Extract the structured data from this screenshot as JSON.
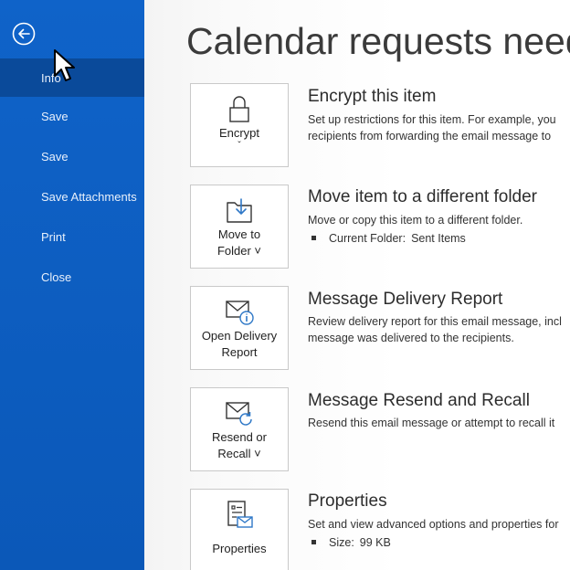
{
  "sidebar": {
    "items": [
      {
        "label": "Info"
      },
      {
        "label": "Save"
      },
      {
        "label": "Save"
      },
      {
        "label": "Save Attachments"
      },
      {
        "label": "Print"
      },
      {
        "label": "Close"
      }
    ]
  },
  "main": {
    "title": "Calendar requests need",
    "sections": [
      {
        "button_label": "Encrypt",
        "title": "Encrypt this item",
        "desc": [
          "Set up restrictions for this item. For example, you",
          "recipients from forwarding the email message to"
        ]
      },
      {
        "button_label_1": "Move to",
        "button_label_2": "Folder ˅",
        "title": "Move item to a different folder",
        "desc": [
          "Move or copy this item to a different folder."
        ],
        "bullet_key": "Current Folder:",
        "bullet_val": "Sent Items"
      },
      {
        "button_label_1": "Open Delivery",
        "button_label_2": "Report",
        "title": "Message Delivery Report",
        "desc": [
          "Review delivery report for this email message, incl",
          "message was delivered to the recipients."
        ]
      },
      {
        "button_label_1": "Resend or",
        "button_label_2": "Recall ˅",
        "title": "Message Resend and Recall",
        "desc": [
          "Resend this email message or attempt to recall it"
        ]
      },
      {
        "button_label": "Properties",
        "title": "Properties",
        "desc": [
          "Set and view advanced options and properties for"
        ],
        "bullet_key": "Size:",
        "bullet_val": "99 KB"
      }
    ]
  },
  "icons": {
    "back": "back-arrow-icon",
    "encrypt": "lock-icon",
    "move": "folder-arrow-icon",
    "delivery": "envelope-info-icon",
    "resend": "envelope-refresh-icon",
    "properties": "properties-icon"
  },
  "colors": {
    "sidebar": "#0f63c9",
    "sidebar_active": "#0a4a9a"
  }
}
